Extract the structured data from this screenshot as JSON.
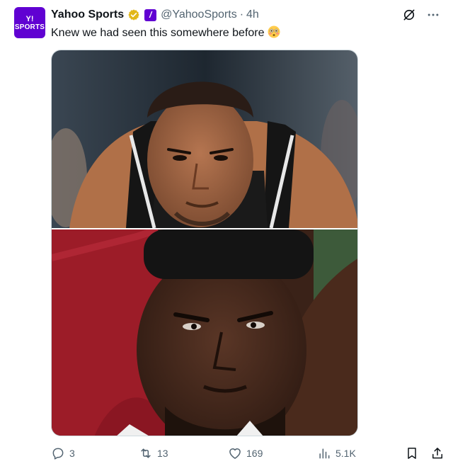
{
  "author": {
    "avatar_text": "SPORTS",
    "display_name": "Yahoo Sports",
    "handle": "@YahooSports",
    "separator": "·",
    "time": "4h",
    "brand_color": "#6001d2",
    "verified_color": "#e2b719"
  },
  "tweet": {
    "text": "Knew we had seen this somewhere before",
    "emoji": "flushed-face"
  },
  "media": {
    "images": [
      {
        "icon": "basketball-player-photo",
        "alt": ""
      },
      {
        "icon": "basketball-player-photo",
        "alt": ""
      }
    ]
  },
  "actions": {
    "reply_count": "3",
    "retweet_count": "13",
    "like_count": "169",
    "view_count": "5.1K"
  },
  "colors": {
    "text": "#0f1419",
    "muted": "#536471",
    "border": "#cfd9de"
  }
}
